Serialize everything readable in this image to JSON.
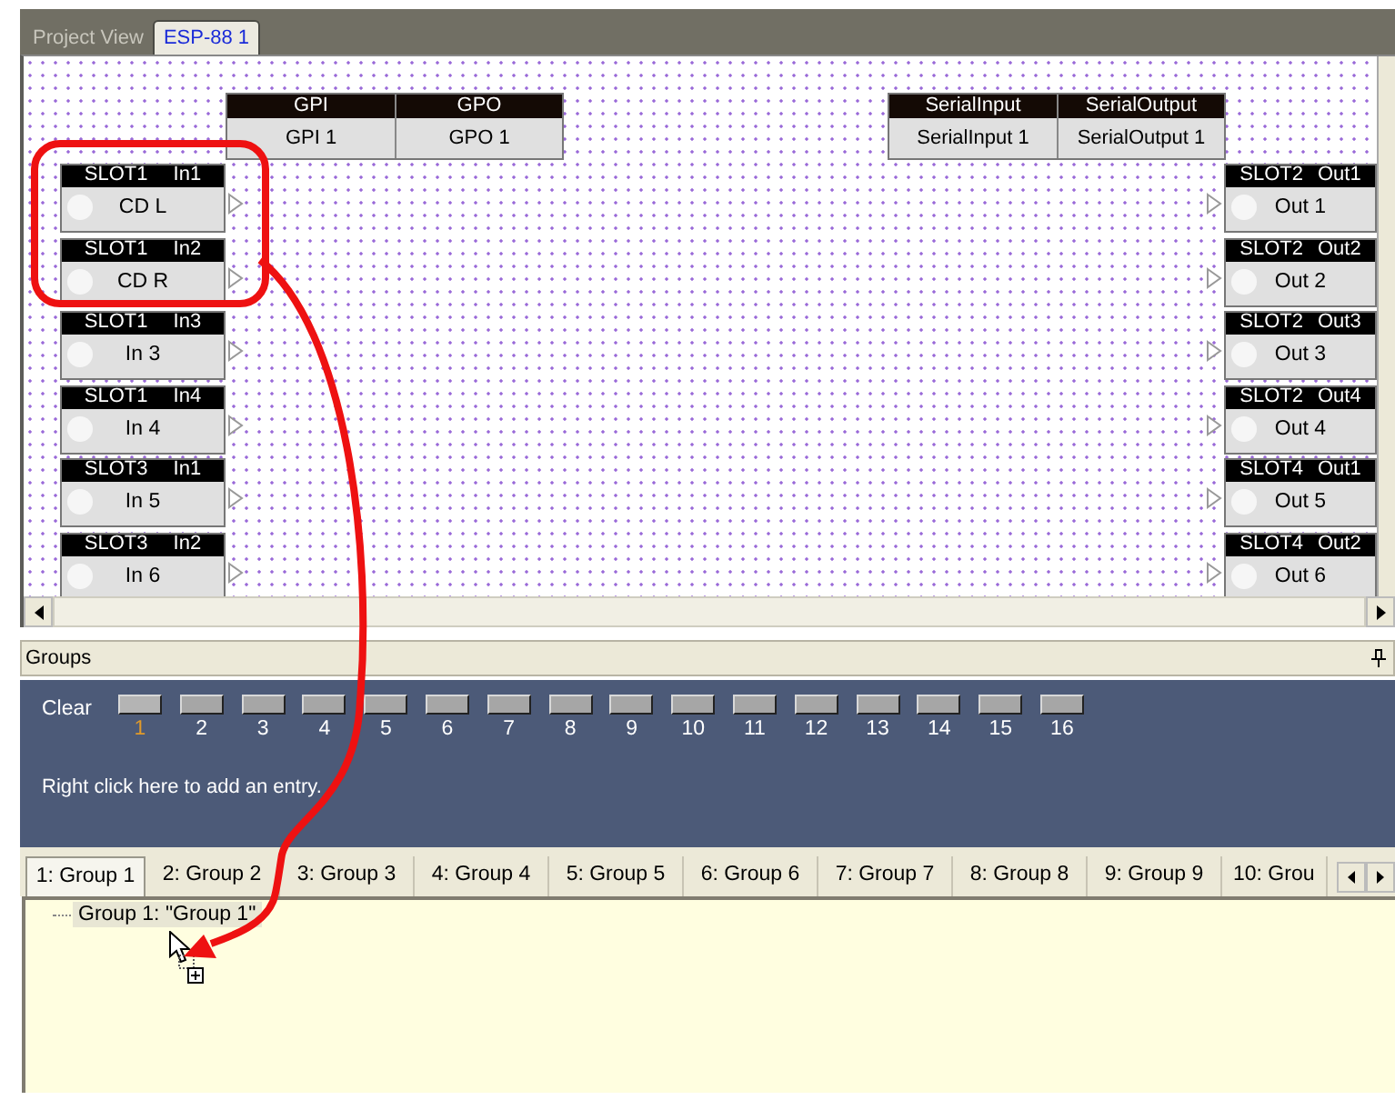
{
  "tabs": [
    {
      "label": "Project View",
      "selected": false
    },
    {
      "label": "ESP-88 1",
      "selected": true
    }
  ],
  "canvas": {
    "io_blocks": [
      {
        "columns": [
          {
            "header": "GPI",
            "value": "GPI 1"
          },
          {
            "header": "GPO",
            "value": "GPO 1"
          }
        ]
      },
      {
        "columns": [
          {
            "header": "SerialInput",
            "value": "SerialInput 1"
          },
          {
            "header": "SerialOutput",
            "value": "SerialOutput 1"
          }
        ]
      }
    ],
    "inputs": [
      {
        "slot": "SLOT1",
        "port": "In1",
        "name": "CD L"
      },
      {
        "slot": "SLOT1",
        "port": "In2",
        "name": "CD R"
      },
      {
        "slot": "SLOT1",
        "port": "In3",
        "name": "In 3"
      },
      {
        "slot": "SLOT1",
        "port": "In4",
        "name": "In 4"
      },
      {
        "slot": "SLOT3",
        "port": "In1",
        "name": "In 5"
      },
      {
        "slot": "SLOT3",
        "port": "In2",
        "name": "In 6"
      }
    ],
    "outputs": [
      {
        "slot": "SLOT2",
        "port": "Out1",
        "name": "Out 1"
      },
      {
        "slot": "SLOT2",
        "port": "Out2",
        "name": "Out 2"
      },
      {
        "slot": "SLOT2",
        "port": "Out3",
        "name": "Out 3"
      },
      {
        "slot": "SLOT2",
        "port": "Out4",
        "name": "Out 4"
      },
      {
        "slot": "SLOT4",
        "port": "Out1",
        "name": "Out 5"
      },
      {
        "slot": "SLOT4",
        "port": "Out2",
        "name": "Out 6"
      }
    ]
  },
  "groups_panel": {
    "title": "Groups",
    "clear_label": "Clear",
    "buttons": [
      {
        "label": "1",
        "selected": true
      },
      {
        "label": "2",
        "selected": false
      },
      {
        "label": "3",
        "selected": false
      },
      {
        "label": "4",
        "selected": false
      },
      {
        "label": "5",
        "selected": false
      },
      {
        "label": "6",
        "selected": false
      },
      {
        "label": "7",
        "selected": false
      },
      {
        "label": "8",
        "selected": false
      },
      {
        "label": "9",
        "selected": false
      },
      {
        "label": "10",
        "selected": false
      },
      {
        "label": "11",
        "selected": false
      },
      {
        "label": "12",
        "selected": false
      },
      {
        "label": "13",
        "selected": false
      },
      {
        "label": "14",
        "selected": false
      },
      {
        "label": "15",
        "selected": false
      },
      {
        "label": "16",
        "selected": false
      }
    ],
    "hint": "Right click here to add an entry.",
    "tabs": [
      {
        "label": "1: Group 1",
        "selected": true
      },
      {
        "label": "2: Group 2",
        "selected": false
      },
      {
        "label": "3: Group 3",
        "selected": false
      },
      {
        "label": "4: Group 4",
        "selected": false
      },
      {
        "label": "5: Group 5",
        "selected": false
      },
      {
        "label": "6: Group 6",
        "selected": false
      },
      {
        "label": "7: Group 7",
        "selected": false
      },
      {
        "label": "8: Group 8",
        "selected": false
      },
      {
        "label": "9: Group 9",
        "selected": false
      },
      {
        "label": "10: Grou",
        "selected": false
      }
    ],
    "tree": [
      {
        "label": "Group 1: \"Group 1\""
      }
    ]
  }
}
